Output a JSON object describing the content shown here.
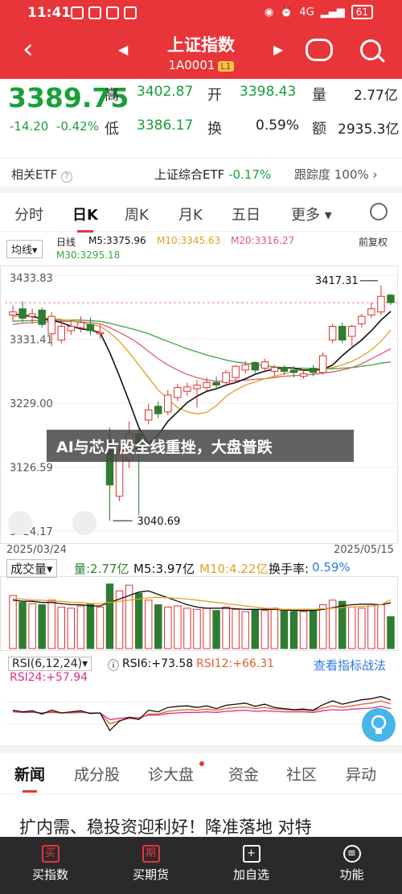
{
  "status": {
    "time": "11:41",
    "battery": "61",
    "net": "4G"
  },
  "header": {
    "title": "上证指数",
    "code": "1A0001",
    "badge": "L1"
  },
  "quote": {
    "price": "3389.75",
    "change": "-14.20",
    "change_pct": "-0.42%",
    "high_label": "高",
    "high": "3402.87",
    "open_label": "开",
    "open": "3398.43",
    "volume_label": "量",
    "volume": "2.77亿",
    "low_label": "低",
    "low": "3386.17",
    "turnover_label": "换",
    "turnover": "0.59%",
    "amount_label": "额",
    "amount": "2935.3亿"
  },
  "etf": {
    "label": "相关ETF",
    "name": "上证综合ETF",
    "change": "-0.17%",
    "tracking_label": "跟踪度",
    "tracking": "100%"
  },
  "tabs": [
    "分时",
    "日K",
    "周K",
    "月K",
    "五日",
    "更多"
  ],
  "legend": {
    "ma_button": "均线",
    "type": "日线",
    "ma5": "M5:3375.96",
    "ma10": "M10:3345.63",
    "ma20": "M20:3316.27",
    "ma30": "M30:3295.18",
    "adjust": "前复权"
  },
  "colors": {
    "ma5": "#111111",
    "ma10": "#e2a020",
    "ma20": "#e05a78",
    "ma30": "#3aa83a",
    "up": "#e03030",
    "down": "#2e7d32"
  },
  "chart_data": {
    "type": "candlestick",
    "y_ticks": [
      "3433.83",
      "3331.41",
      "3229.00",
      "3126.59",
      "3024.17"
    ],
    "ylim": [
      3024.17,
      3433.83
    ],
    "x_labels": [
      "2025/03/24",
      "2025/05/15"
    ],
    "max_label": "3417.31",
    "min_label": "3040.69",
    "candles": [
      {
        "o": 3370,
        "c": 3375,
        "h": 3385,
        "l": 3360
      },
      {
        "o": 3380,
        "c": 3365,
        "h": 3392,
        "l": 3358
      },
      {
        "o": 3368,
        "c": 3372,
        "h": 3380,
        "l": 3356
      },
      {
        "o": 3378,
        "c": 3355,
        "h": 3382,
        "l": 3350
      },
      {
        "o": 3340,
        "c": 3368,
        "h": 3375,
        "l": 3320
      },
      {
        "o": 3330,
        "c": 3352,
        "h": 3360,
        "l": 3325
      },
      {
        "o": 3345,
        "c": 3352,
        "h": 3362,
        "l": 3338
      },
      {
        "o": 3350,
        "c": 3358,
        "h": 3368,
        "l": 3342
      },
      {
        "o": 3355,
        "c": 3345,
        "h": 3366,
        "l": 3338
      },
      {
        "o": 3340,
        "c": 3342,
        "h": 3355,
        "l": 3332
      },
      {
        "o": 3168,
        "c": 3098,
        "h": 3190,
        "l": 3040.69
      },
      {
        "o": 3080,
        "c": 3150,
        "h": 3160,
        "l": 3072
      },
      {
        "o": 3138,
        "c": 3180,
        "h": 3200,
        "l": 3125
      },
      {
        "o": 3180,
        "c": 3155,
        "h": 3188,
        "l": 3050
      },
      {
        "o": 3202,
        "c": 3218,
        "h": 3228,
        "l": 3195
      },
      {
        "o": 3224,
        "c": 3212,
        "h": 3232,
        "l": 3205
      },
      {
        "o": 3215,
        "c": 3242,
        "h": 3250,
        "l": 3210
      },
      {
        "o": 3238,
        "c": 3254,
        "h": 3260,
        "l": 3232
      },
      {
        "o": 3248,
        "c": 3255,
        "h": 3262,
        "l": 3240
      },
      {
        "o": 3252,
        "c": 3258,
        "h": 3266,
        "l": 3222
      },
      {
        "o": 3254,
        "c": 3262,
        "h": 3270,
        "l": 3248
      },
      {
        "o": 3262,
        "c": 3258,
        "h": 3272,
        "l": 3250
      },
      {
        "o": 3262,
        "c": 3278,
        "h": 3282,
        "l": 3255
      },
      {
        "o": 3270,
        "c": 3288,
        "h": 3290,
        "l": 3262
      },
      {
        "o": 3282,
        "c": 3290,
        "h": 3296,
        "l": 3276
      },
      {
        "o": 3294,
        "c": 3282,
        "h": 3296,
        "l": 3275
      },
      {
        "o": 3285,
        "c": 3295,
        "h": 3300,
        "l": 3278
      },
      {
        "o": 3280,
        "c": 3286,
        "h": 3290,
        "l": 3272
      },
      {
        "o": 3286,
        "c": 3280,
        "h": 3290,
        "l": 3274
      },
      {
        "o": 3282,
        "c": 3278,
        "h": 3288,
        "l": 3270
      },
      {
        "o": 3272,
        "c": 3276,
        "h": 3282,
        "l": 3268
      },
      {
        "o": 3285,
        "c": 3278,
        "h": 3290,
        "l": 3272
      },
      {
        "o": 3278,
        "c": 3305,
        "h": 3310,
        "l": 3275
      },
      {
        "o": 3330,
        "c": 3352,
        "h": 3356,
        "l": 3325
      },
      {
        "o": 3352,
        "c": 3330,
        "h": 3358,
        "l": 3325
      },
      {
        "o": 3336,
        "c": 3352,
        "h": 3355,
        "l": 3320
      },
      {
        "o": 3356,
        "c": 3368,
        "h": 3372,
        "l": 3350
      },
      {
        "o": 3370,
        "c": 3380,
        "h": 3390,
        "l": 3365
      },
      {
        "o": 3375,
        "c": 3400,
        "h": 3417.31,
        "l": 3370
      },
      {
        "o": 3402,
        "c": 3390,
        "h": 3404,
        "l": 3386
      }
    ],
    "ma5": [
      3372,
      3370,
      3368,
      3364,
      3362,
      3358,
      3352,
      3348,
      3346,
      3342,
      3310,
      3272,
      3232,
      3190,
      3164,
      3178,
      3200,
      3215,
      3230,
      3240,
      3248,
      3252,
      3258,
      3262,
      3268,
      3275,
      3280,
      3284,
      3286,
      3285,
      3282,
      3282,
      3283,
      3290,
      3305,
      3318,
      3330,
      3345,
      3362,
      3376
    ],
    "ma10": [
      3368,
      3368,
      3367,
      3366,
      3365,
      3363,
      3361,
      3358,
      3355,
      3352,
      3342,
      3328,
      3310,
      3290,
      3270,
      3250,
      3235,
      3222,
      3215,
      3212,
      3214,
      3225,
      3240,
      3250,
      3258,
      3263,
      3268,
      3272,
      3276,
      3280,
      3282,
      3283,
      3284,
      3286,
      3290,
      3296,
      3304,
      3314,
      3328,
      3346
    ],
    "ma20": [
      3355,
      3357,
      3358,
      3359,
      3359,
      3360,
      3360,
      3359,
      3358,
      3356,
      3350,
      3342,
      3334,
      3324,
      3312,
      3300,
      3290,
      3282,
      3275,
      3270,
      3266,
      3264,
      3264,
      3265,
      3266,
      3267,
      3268,
      3270,
      3272,
      3273,
      3274,
      3275,
      3277,
      3279,
      3282,
      3286,
      3292,
      3300,
      3308,
      3316
    ],
    "ma30": [
      3360,
      3361,
      3361,
      3362,
      3362,
      3362,
      3362,
      3362,
      3361,
      3360,
      3357,
      3353,
      3349,
      3345,
      3340,
      3334,
      3328,
      3322,
      3316,
      3311,
      3306,
      3302,
      3298,
      3295,
      3293,
      3291,
      3289,
      3287,
      3286,
      3285,
      3285,
      3284,
      3284,
      3284,
      3285,
      3286,
      3288,
      3290,
      3293,
      3295
    ]
  },
  "volume": {
    "label": "成交量",
    "cur": "量:2.77亿",
    "m5": "M5:3.97亿",
    "m10": "M10:4.22亿",
    "turnover_label": "换手率:",
    "turnover": "0.59%",
    "values": [
      4.6,
      4.0,
      3.9,
      3.8,
      4.2,
      3.6,
      3.5,
      3.7,
      3.9,
      3.6,
      5.6,
      5.0,
      5.5,
      4.8,
      4.2,
      3.8,
      3.6,
      3.7,
      3.5,
      3.4,
      3.5,
      3.3,
      3.6,
      3.4,
      3.2,
      3.4,
      3.3,
      3.5,
      3.3,
      3.2,
      3.2,
      3.4,
      3.8,
      4.2,
      4.1,
      3.6,
      3.5,
      3.7,
      3.8,
      2.77
    ],
    "up": [
      1,
      0,
      1,
      0,
      1,
      1,
      1,
      1,
      0,
      1,
      0,
      1,
      1,
      0,
      1,
      0,
      1,
      1,
      1,
      1,
      1,
      0,
      1,
      1,
      1,
      0,
      1,
      1,
      0,
      0,
      1,
      0,
      1,
      1,
      0,
      1,
      1,
      1,
      1,
      0
    ],
    "ma5": [
      4.2,
      4.1,
      4.1,
      4.0,
      4.0,
      3.9,
      3.8,
      3.8,
      3.7,
      3.7,
      4.0,
      4.3,
      4.6,
      4.9,
      5.0,
      4.7,
      4.4,
      4.1,
      3.8,
      3.6,
      3.5,
      3.5,
      3.5,
      3.45,
      3.4,
      3.4,
      3.4,
      3.4,
      3.35,
      3.3,
      3.3,
      3.3,
      3.4,
      3.55,
      3.7,
      3.8,
      3.85,
      3.85,
      3.8,
      3.97
    ],
    "ma10": [
      4.3,
      4.3,
      4.2,
      4.2,
      4.1,
      4.1,
      4.0,
      4.0,
      3.9,
      3.9,
      4.0,
      4.1,
      4.2,
      4.3,
      4.4,
      4.45,
      4.4,
      4.35,
      4.3,
      4.2,
      4.1,
      4.0,
      3.9,
      3.8,
      3.7,
      3.6,
      3.5,
      3.45,
      3.4,
      3.4,
      3.4,
      3.4,
      3.45,
      3.5,
      3.55,
      3.6,
      3.65,
      3.7,
      3.8,
      4.22
    ]
  },
  "rsi": {
    "label": "RSI(6,12,24)",
    "rsi6": "RSI6:+73.58",
    "rsi12": "RSI12:+66.31",
    "rsi24": "RSI24:+57.94",
    "link": "查看指标战法",
    "r6": [
      55,
      52,
      54,
      48,
      55,
      50,
      52,
      54,
      49,
      50,
      18,
      35,
      42,
      38,
      55,
      52,
      60,
      62,
      63,
      60,
      63,
      58,
      64,
      66,
      68,
      62,
      66,
      60,
      58,
      56,
      57,
      55,
      65,
      72,
      66,
      70,
      74,
      76,
      80,
      73.58
    ],
    "r12": [
      53,
      52,
      52,
      50,
      52,
      50,
      51,
      52,
      50,
      50,
      30,
      36,
      40,
      39,
      48,
      48,
      53,
      55,
      56,
      55,
      57,
      55,
      58,
      60,
      61,
      58,
      60,
      57,
      56,
      55,
      55,
      54,
      59,
      63,
      60,
      63,
      66,
      68,
      72,
      66.31
    ],
    "r24": [
      52,
      51,
      51,
      50,
      51,
      50,
      50,
      51,
      50,
      50,
      38,
      40,
      42,
      41,
      46,
      46,
      49,
      50,
      51,
      51,
      52,
      51,
      53,
      54,
      55,
      53,
      54,
      53,
      52,
      52,
      52,
      51,
      54,
      56,
      55,
      57,
      58,
      59,
      62,
      57.94
    ]
  },
  "news_tabs": [
    "新闻",
    "成分股",
    "诊大盘",
    "资金",
    "社区",
    "异动"
  ],
  "headline": "扩内需、稳投资迎利好！降准落地 对特",
  "banner": "AI与芯片股全线重挫，大盘普跌",
  "bottom_nav": [
    {
      "icon": "买",
      "label": "买指数"
    },
    {
      "icon": "期",
      "label": "买期货"
    },
    {
      "icon": "+",
      "label": "加自选"
    },
    {
      "icon": "≡",
      "label": "功能"
    }
  ]
}
